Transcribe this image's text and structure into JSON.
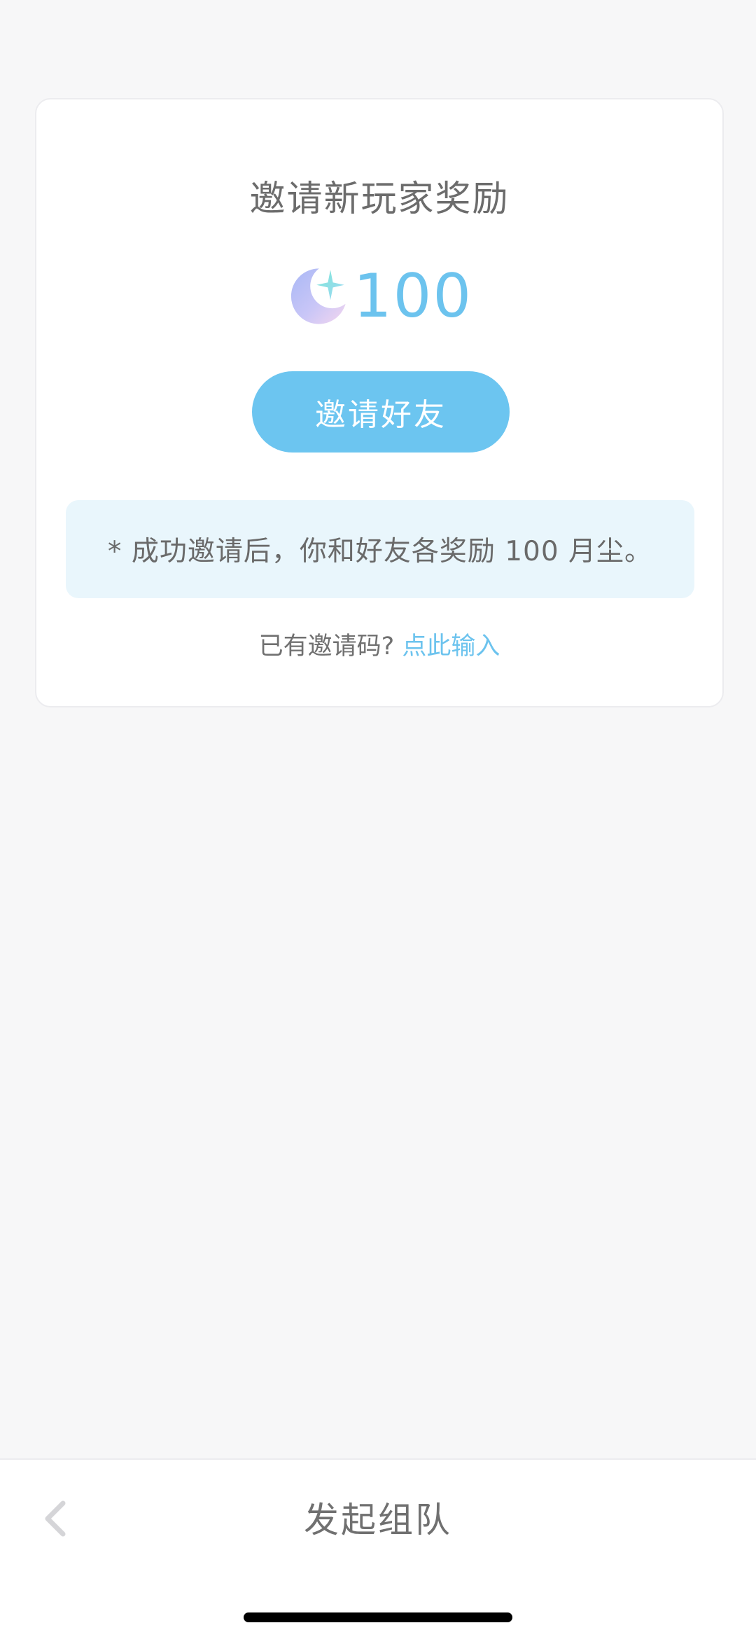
{
  "card": {
    "title": "邀请新玩家奖励",
    "reward": {
      "amount": "100",
      "icon": "moon-star-icon"
    },
    "invite_button": "邀请好友",
    "note": "* 成功邀请后，你和好友各奖励 100 月尘。",
    "code_prompt": "已有邀请码?",
    "code_link": "点此输入"
  },
  "bottom_bar": {
    "back_icon": "chevron-left-icon",
    "title": "发起组队"
  },
  "colors": {
    "accent": "#6cc5f0",
    "accent_text": "#6cc3ee",
    "note_bg": "#e9f6fc",
    "page_bg": "#f7f7f8"
  }
}
